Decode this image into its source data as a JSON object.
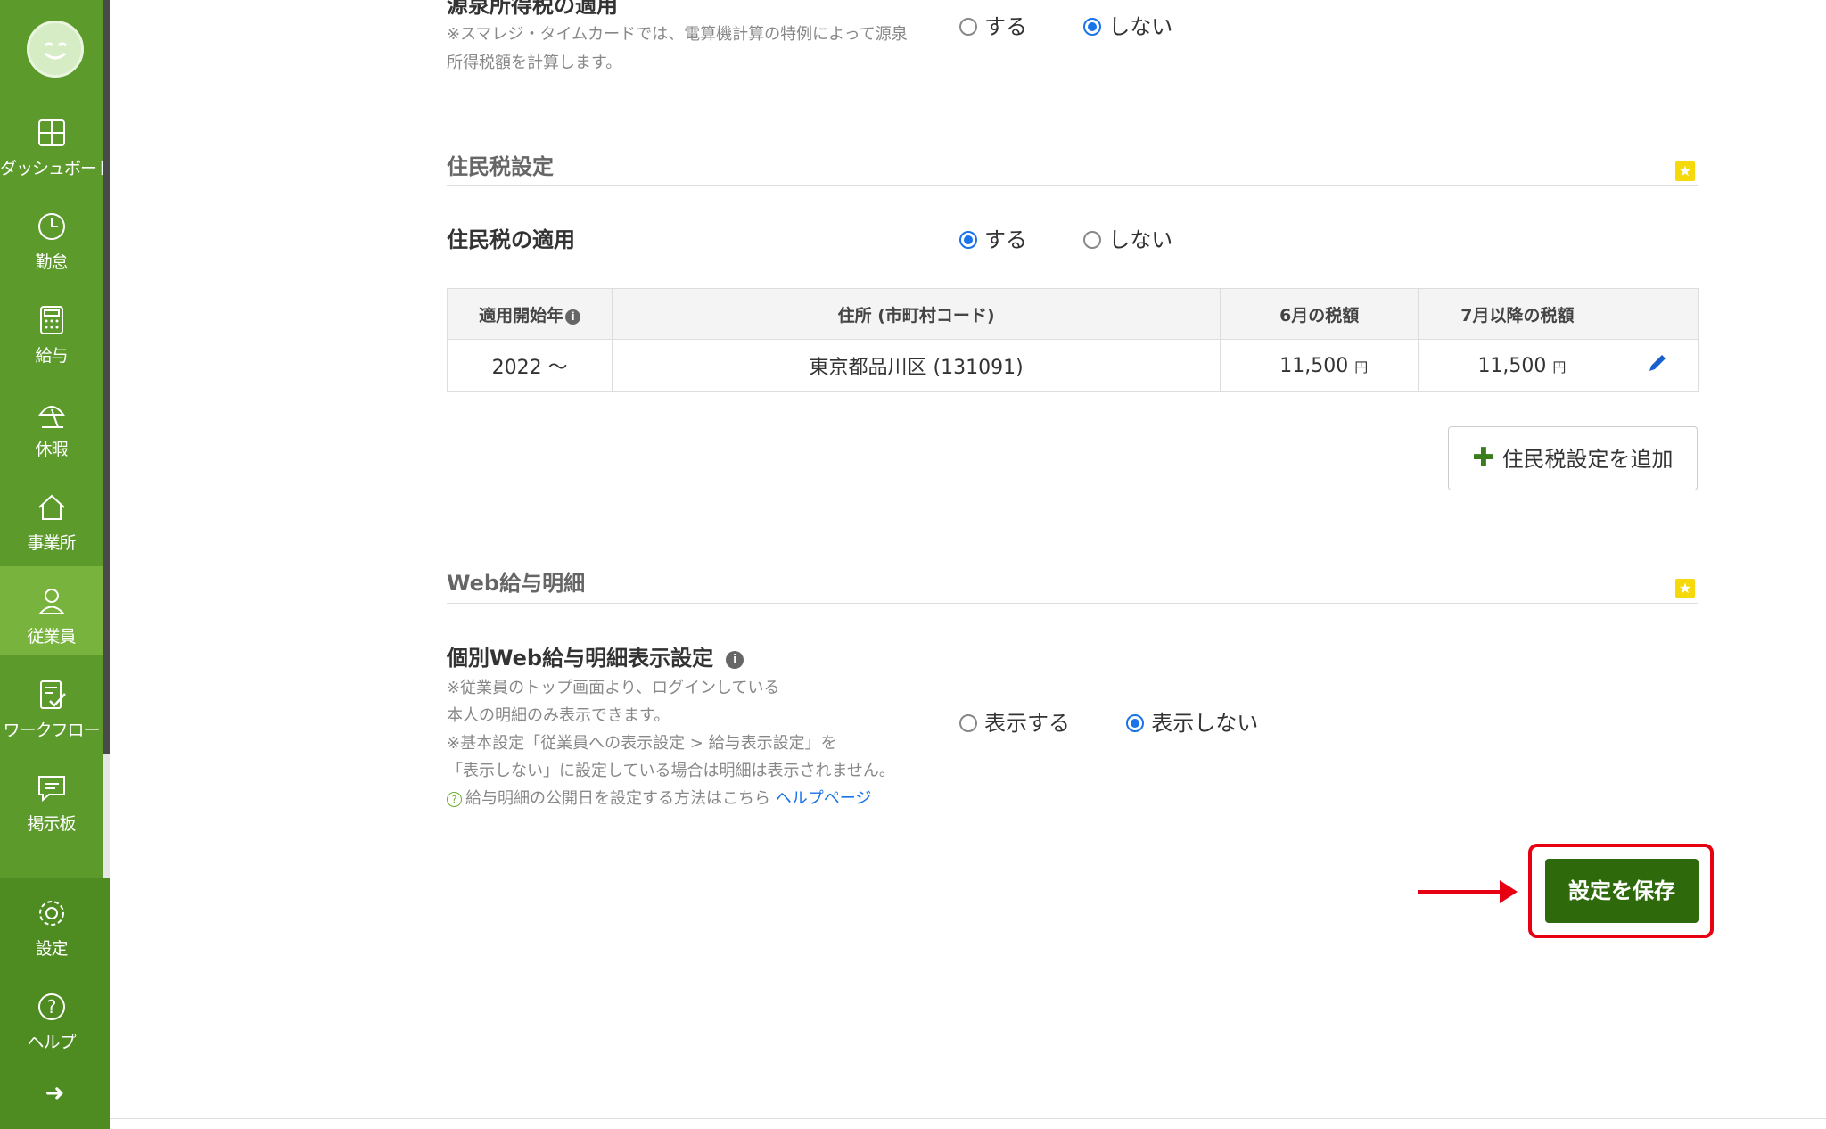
{
  "sidebar": {
    "items": [
      {
        "label": "ダッシュボード",
        "icon": "dashboard-icon"
      },
      {
        "label": "勤怠",
        "icon": "clock-icon"
      },
      {
        "label": "給与",
        "icon": "calculator-icon"
      },
      {
        "label": "休暇",
        "icon": "parasol-icon"
      },
      {
        "label": "事業所",
        "icon": "home-icon"
      },
      {
        "label": "従業員",
        "icon": "person-icon"
      },
      {
        "label": "ワークフロー",
        "icon": "checklist-icon"
      },
      {
        "label": "掲示板",
        "icon": "chat-icon"
      },
      {
        "label": "設定",
        "icon": "gear-icon"
      },
      {
        "label": "ヘルプ",
        "icon": "help-icon"
      }
    ],
    "active": "従業員",
    "collapse_icon": "arrow-right-icon"
  },
  "withholding": {
    "title": "源泉所得税の適用",
    "note_line1": "※スマレジ・タイムカードでは、電算機計算の特例によって源泉",
    "note_line2": "所得税額を計算します。",
    "option_yes": "する",
    "option_no": "しない",
    "selected": "しない"
  },
  "resident_tax": {
    "section_title": "住民税設定",
    "label": "住民税の適用",
    "option_yes": "する",
    "option_no": "しない",
    "selected": "する",
    "table": {
      "headers": [
        "適用開始年",
        "住所 (市町村コード)",
        "6月の税額",
        "7月以降の税額"
      ],
      "rows": [
        {
          "start": "2022 〜",
          "address": "東京都品川区 (131091)",
          "june": "11,500",
          "july_after": "11,500",
          "unit": "円"
        }
      ]
    },
    "add_button": "住民税設定を追加"
  },
  "web_payslip": {
    "section_title": "Web給与明細",
    "label": "個別Web給与明細表示設定",
    "note_line1": "※従業員のトップ画面より、ログインしている",
    "note_line2": "本人の明細のみ表示できます。",
    "note_line3": "※基本設定「従業員への表示設定 > 給与表示設定」を",
    "note_line4": "「表示しない」に設定している場合は明細は表示されません。",
    "help_text": "給与明細の公開日を設定する方法はこちら",
    "help_link": "ヘルプページ",
    "option_show": "表示する",
    "option_hide": "表示しない",
    "selected": "表示しない"
  },
  "save_button": "設定を保存",
  "colors": {
    "sidebar_green": "#5c9a2b",
    "active_green": "#78b33d",
    "save_green": "#2e6a0c",
    "highlight_red": "#e60012",
    "radio_blue": "#1a73e8"
  }
}
